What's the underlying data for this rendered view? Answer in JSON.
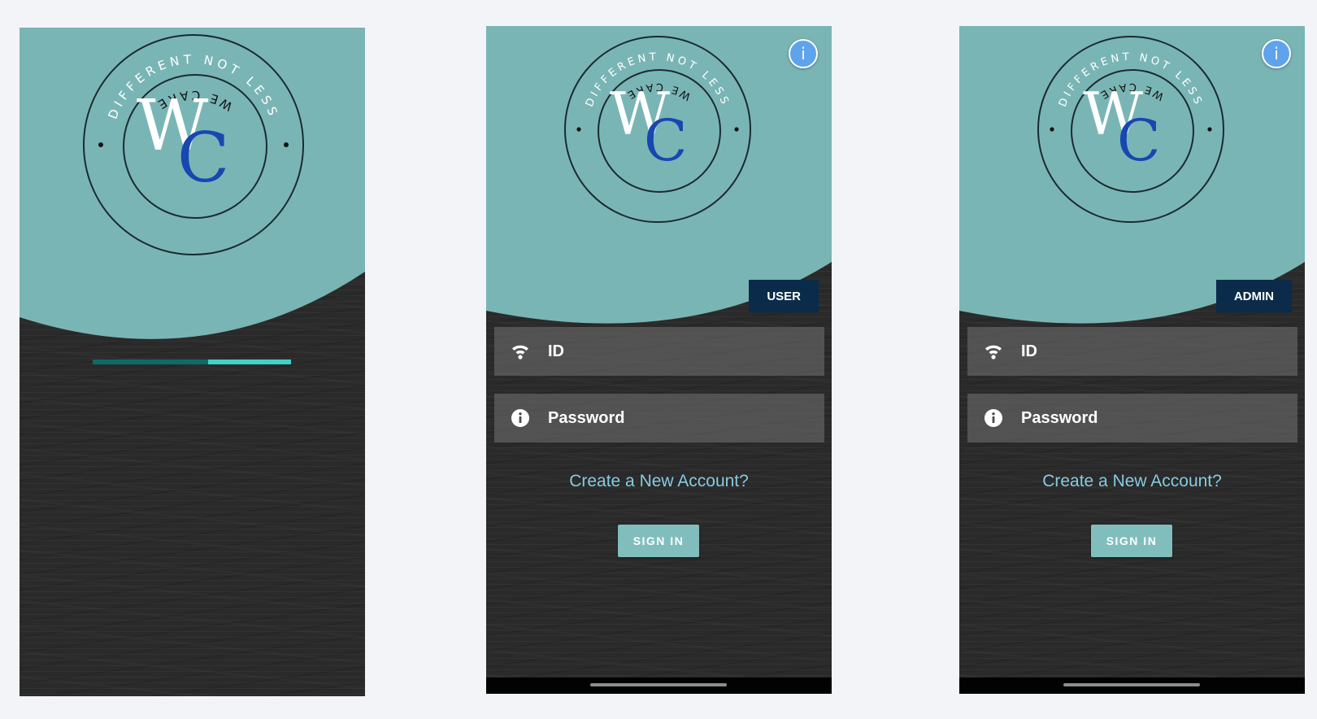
{
  "logo": {
    "top_text": "DIFFERENT NOT LESS",
    "bottom_text": "WE CARE",
    "monogram_w": "W",
    "monogram_c": "C"
  },
  "colors": {
    "teal": "#7ab5b5",
    "progress_track": "#0f6b66",
    "progress_fill": "#3ed3c9",
    "badge": "#0b2b4a",
    "link": "#86cbe0",
    "button": "#80bebd",
    "info": "#5fa3ec",
    "monogram_c": "#1747b0"
  },
  "splash": {
    "progress": 0.42
  },
  "screens": [
    {
      "role": "USER",
      "info_label": "i",
      "id_label": "ID",
      "password_label": "Password",
      "create_account": "Create a New Account?",
      "sign_in": "SIGN IN"
    },
    {
      "role": "ADMIN",
      "info_label": "i",
      "id_label": "ID",
      "password_label": "Password",
      "create_account": "Create a New Account?",
      "sign_in": "SIGN IN"
    }
  ],
  "icons": [
    "info-icon",
    "id-icon",
    "password-info-icon"
  ]
}
